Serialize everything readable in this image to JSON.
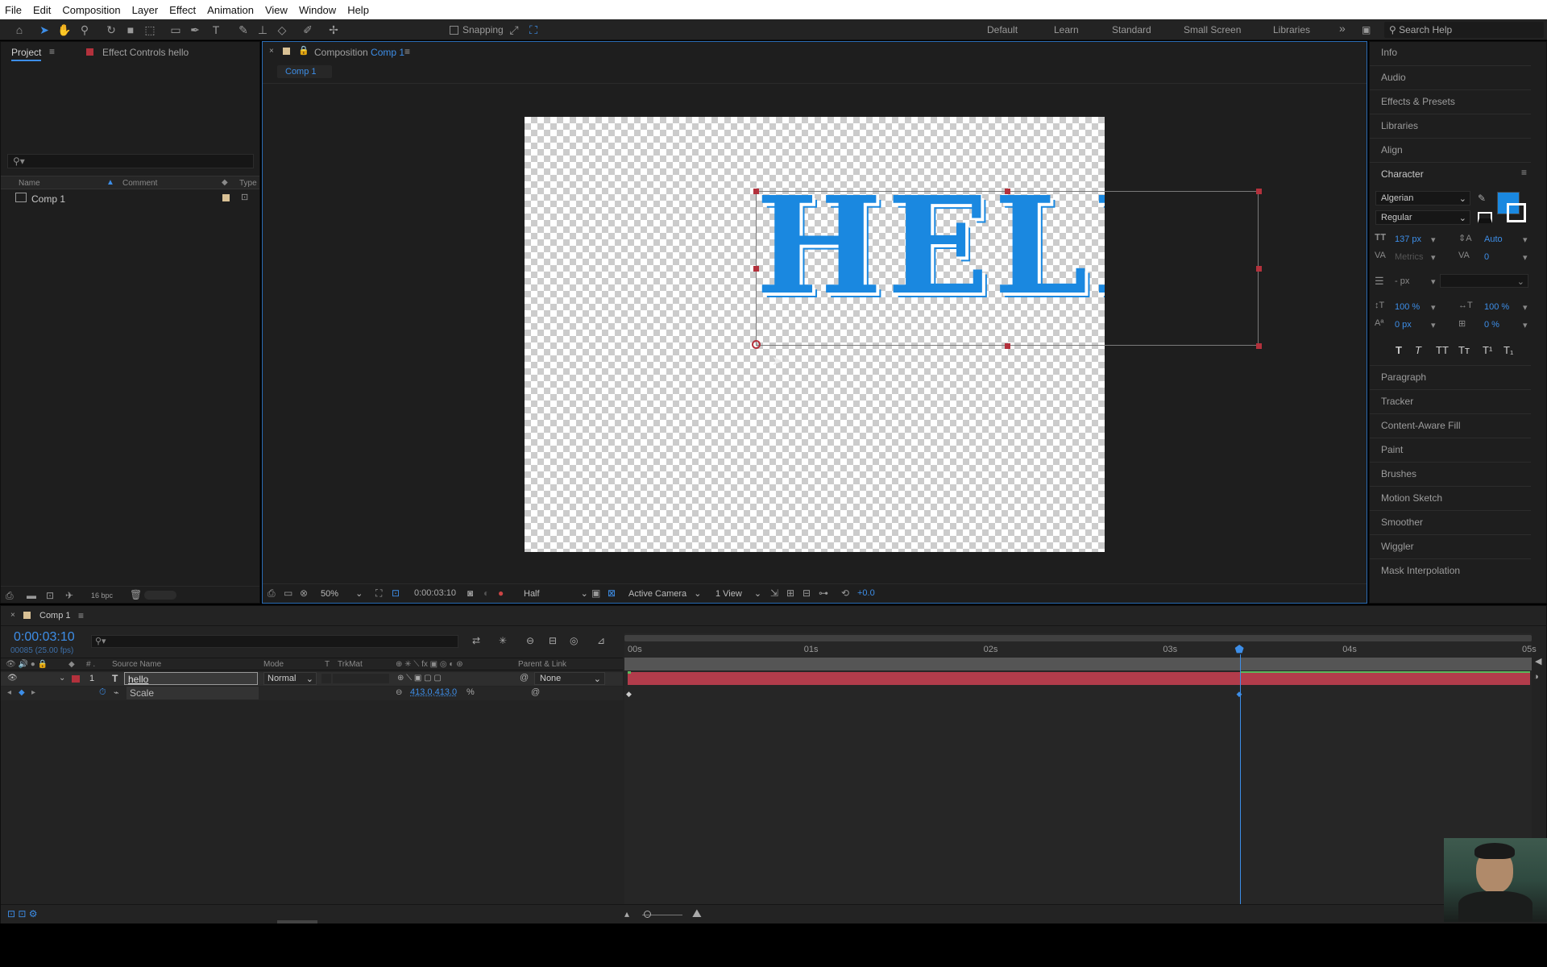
{
  "menu": [
    "File",
    "Edit",
    "Composition",
    "Layer",
    "Effect",
    "Animation",
    "View",
    "Window",
    "Help"
  ],
  "toolbar": {
    "snapping_label": "Snapping",
    "workspaces": [
      "Default",
      "Learn",
      "Standard",
      "Small Screen",
      "Libraries"
    ],
    "search_placeholder": "Search Help"
  },
  "project_panel": {
    "tab_project": "Project",
    "tab_effect_controls": "Effect Controls hello",
    "columns": {
      "name": "Name",
      "comment": "Comment",
      "type": "Type"
    },
    "items": [
      {
        "name": "Comp 1"
      }
    ],
    "bpc": "16 bpc"
  },
  "composition_panel": {
    "tab_label": "Composition",
    "comp_name": "Comp 1",
    "breadcrumb": "Comp 1",
    "footer": {
      "zoom": "50%",
      "timecode": "0:00:03:10",
      "resolution": "Half",
      "camera": "Active Camera",
      "views": "1 View",
      "exposure": "+0.0"
    },
    "text_layer": "HELL"
  },
  "right_panels": {
    "top_items": [
      "Info",
      "Audio",
      "Effects & Presets",
      "Libraries",
      "Align"
    ],
    "character": {
      "title": "Character",
      "font": "Algerian",
      "style": "Regular",
      "size": "137 px",
      "leading": "Auto",
      "kerning": "Metrics",
      "tracking": "0",
      "stroke": "- px",
      "vscale": "100 %",
      "hscale": "100 %",
      "baseline": "0 px",
      "tsume": "0 %",
      "fill_color": "#1a88e0",
      "format_buttons": [
        "T",
        "T",
        "TT",
        "Tт",
        "T¹",
        "T₁"
      ]
    },
    "bottom_items": [
      "Paragraph",
      "Tracker",
      "Content-Aware Fill",
      "Paint",
      "Brushes",
      "Motion Sketch",
      "Smoother",
      "Wiggler",
      "Mask Interpolation"
    ]
  },
  "timeline": {
    "tab": "Comp 1",
    "current_time": "0:00:03:10",
    "frame_info": "00085 (25.00 fps)",
    "columns": {
      "source": "Source Name",
      "mode": "Mode",
      "t": "T",
      "trkmat": "TrkMat",
      "parent": "Parent & Link"
    },
    "layer": {
      "index": "1",
      "name": "hello",
      "mode": "Normal",
      "parent": "None"
    },
    "property": {
      "name": "Scale",
      "value": "413.0,413.0",
      "unit": "%"
    },
    "ruler": [
      "00s",
      "01s",
      "02s",
      "03s",
      "04s",
      "05s"
    ],
    "playhead_seconds": 3.4,
    "duration_seconds": 5
  }
}
